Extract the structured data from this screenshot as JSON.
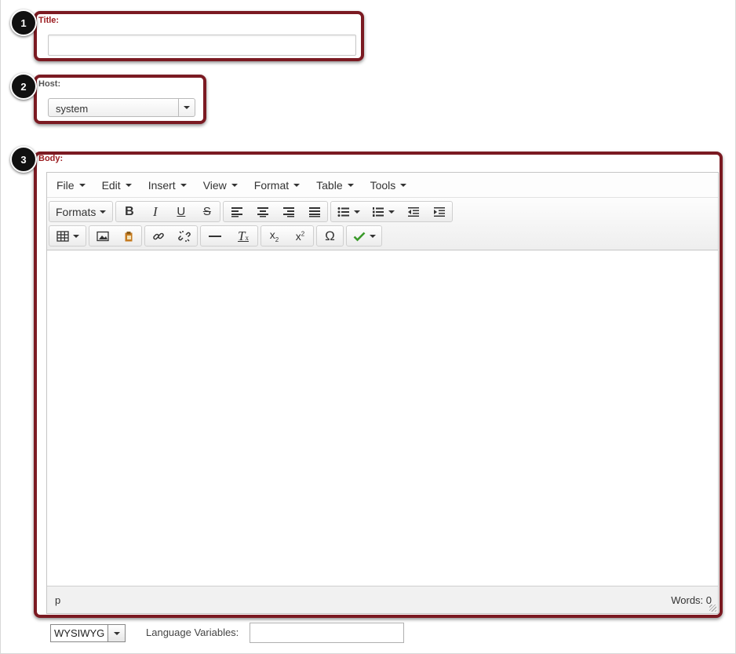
{
  "callouts": [
    "1",
    "2",
    "3"
  ],
  "title_field": {
    "label": "Title:",
    "value": ""
  },
  "host_field": {
    "label": "Host:",
    "selected": "system"
  },
  "body_field": {
    "label": "Body:"
  },
  "menubar": [
    "File",
    "Edit",
    "Insert",
    "View",
    "Format",
    "Table",
    "Tools"
  ],
  "toolbar": {
    "formats_label": "Formats"
  },
  "statusbar": {
    "path": "p",
    "word_count": "Words: 0"
  },
  "bottom": {
    "mode_selected": "WYSIWYG",
    "language_label": "Language Variables:",
    "language_value": ""
  },
  "colors": {
    "callout_border": "#7b1a22",
    "required_label": "#9b1c20",
    "check_green": "#3a9a2a"
  }
}
